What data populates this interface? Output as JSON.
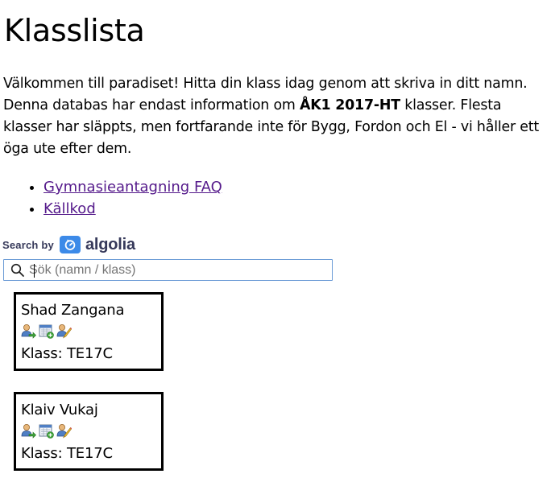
{
  "page": {
    "title": "Klasslista",
    "intro_part1": "Välkommen till paradiset! Hitta din klass idag genom att skriva in ditt namn. Denna databas har endast information om ",
    "intro_bold": "ÅK1 2017-HT",
    "intro_part2": " klasser. Flesta klasser har släppts, men fortfarande inte för Bygg, Fordon och El - vi håller ett öga ute efter dem."
  },
  "links": [
    {
      "label": "Gymnasieantagning FAQ"
    },
    {
      "label": "Källkod"
    }
  ],
  "search": {
    "powered_by": "Search by",
    "brand": "algolia",
    "placeholder": "Sök (namn / klass)",
    "value": "",
    "icon": "search-icon"
  },
  "results": [
    {
      "name": "Shad Zangana",
      "klass": "Klass: TE17C",
      "icons": [
        "user-arrow-icon",
        "calendar-add-icon",
        "user-edit-icon"
      ]
    },
    {
      "name": "Klaiv Vukaj",
      "klass": "Klass: TE17C",
      "icons": [
        "user-arrow-icon",
        "calendar-add-icon",
        "user-edit-icon"
      ]
    }
  ],
  "colors": {
    "link": "#551a8b",
    "search_border": "#6b9bd6",
    "algolia_blue": "#3c8ae8",
    "algolia_text": "#36395a"
  }
}
